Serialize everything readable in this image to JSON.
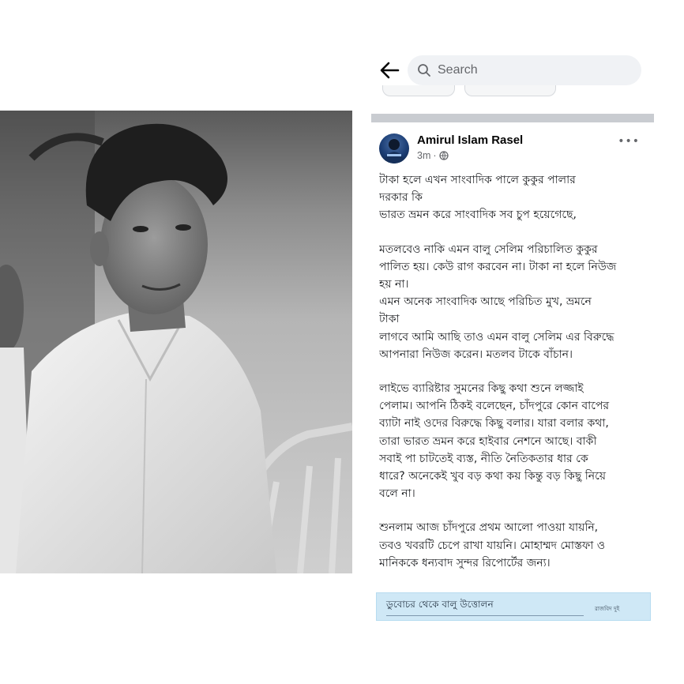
{
  "search": {
    "placeholder": "Search"
  },
  "post": {
    "author": "Amirul Islam Rasel",
    "time": "3m",
    "separator": "·",
    "more": "•••",
    "paragraphs": [
      [
        "টাকা হলে এখন সাংবাদিক পালে কুকুর পালার",
        "দরকার কি",
        "ভারত ভ্রমন করে সাংবাদিক সব চুপ হয়েগেছে,"
      ],
      [
        "মতলবেও নাকি এমন বালু সেলিম পরিচালিত কুকুর",
        "পালিত হয়। কেউ রাগ করবেন না। টাকা না হলে নিউজ",
        "হয় না।",
        "এমন অনেক সাংবাদিক আছে পরিচিত মুখ, ভ্রমনে",
        "টাকা",
        "লাগবে আমি আছি তাও এমন বালু সেলিম এর বিরুদ্ধে",
        "আপনারা নিউজ করেন। মতলব টাকে বাঁচান।"
      ],
      [
        "লাইভে ব্যারিষ্টার সুমনের কিছু কথা শুনে লজ্জাই",
        "পেলাম। আপনি ঠিকই বলেছেন, চাঁদপুরে কোন বাপের",
        "ব্যাটা নাই ওদের বিরুদ্ধে কিছু বলার। যারা বলার কথা,",
        "তারা ভারত ভ্রমন করে হাইবার নেশনে আছে। বাকী",
        "সবাই পা চাটতেই ব্যস্ত, নীতি নৈতিকতার ধার কে",
        "ধারে? অনেকেই খুব বড় কথা কয় কিন্তু বড় কিছু নিয়ে",
        "বলে না।"
      ],
      [
        "শুনলাম আজ চাঁদপুরে প্রথম আলো পাওয়া যায়নি,",
        "তবও খবরটি চেপে রাখা যায়নি। মোহাম্মদ মোস্তফা ও",
        "মানিককে ধন্যবাদ সুন্দর রিপোর্টের জন্য।"
      ]
    ]
  },
  "link_preview": {
    "title": "ডুবোচর থেকে বালু উত্তোলন",
    "side_text": "রাজবিদ দুই"
  },
  "colors": {
    "search_bg": "#f0f2f5",
    "divider": "#c9ccd1",
    "meta_text": "#65676b",
    "link_bg": "#cfe8f6"
  }
}
